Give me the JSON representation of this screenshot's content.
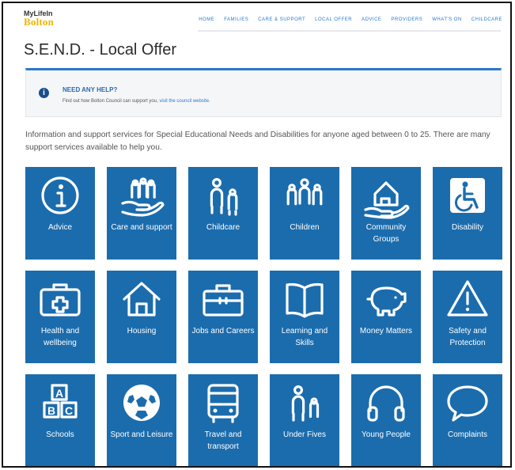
{
  "header": {
    "logo_line1": "MyLifeIn",
    "logo_line2": "Bolton",
    "nav": [
      "HOME",
      "FAMILIES",
      "CARE & SUPPORT",
      "LOCAL OFFER",
      "ADVICE",
      "PROVIDERS",
      "WHAT'S ON",
      "CHILDCARE"
    ]
  },
  "page_title": "S.E.N.D. - Local Offer",
  "help": {
    "icon": "info-icon",
    "title": "NEED ANY HELP?",
    "text": "Find out how Bolton Council can support you,",
    "link": "visit the council website."
  },
  "intro": "Information and support services for Special Educational Needs and Disabilities for anyone aged between 0 to 25. There are many support services available to help you.",
  "tile_color": "#1b6cad",
  "tiles": [
    {
      "label": "Advice",
      "icon": "info-circle-icon"
    },
    {
      "label": "Care and support",
      "icon": "hand-people-icon"
    },
    {
      "label": "Childcare",
      "icon": "adult-child-icon"
    },
    {
      "label": "Children",
      "icon": "children-group-icon"
    },
    {
      "label": "Community Groups",
      "icon": "house-hand-icon"
    },
    {
      "label": "Disability",
      "icon": "wheelchair-icon"
    },
    {
      "label": "Health and wellbeing",
      "icon": "medical-case-icon"
    },
    {
      "label": "Housing",
      "icon": "house-icon"
    },
    {
      "label": "Jobs and Careers",
      "icon": "toolbox-icon"
    },
    {
      "label": "Learning and Skills",
      "icon": "open-book-icon"
    },
    {
      "label": "Money Matters",
      "icon": "piggy-bank-icon"
    },
    {
      "label": "Safety and Protection",
      "icon": "warning-icon"
    },
    {
      "label": "Schools",
      "icon": "abc-blocks-icon"
    },
    {
      "label": "Sport and Leisure",
      "icon": "football-icon"
    },
    {
      "label": "Travel and transport",
      "icon": "bus-icon"
    },
    {
      "label": "Under Fives",
      "icon": "parent-toddler-icon"
    },
    {
      "label": "Young People",
      "icon": "headphones-icon"
    },
    {
      "label": "Complaints",
      "icon": "speech-bubble-icon"
    }
  ]
}
